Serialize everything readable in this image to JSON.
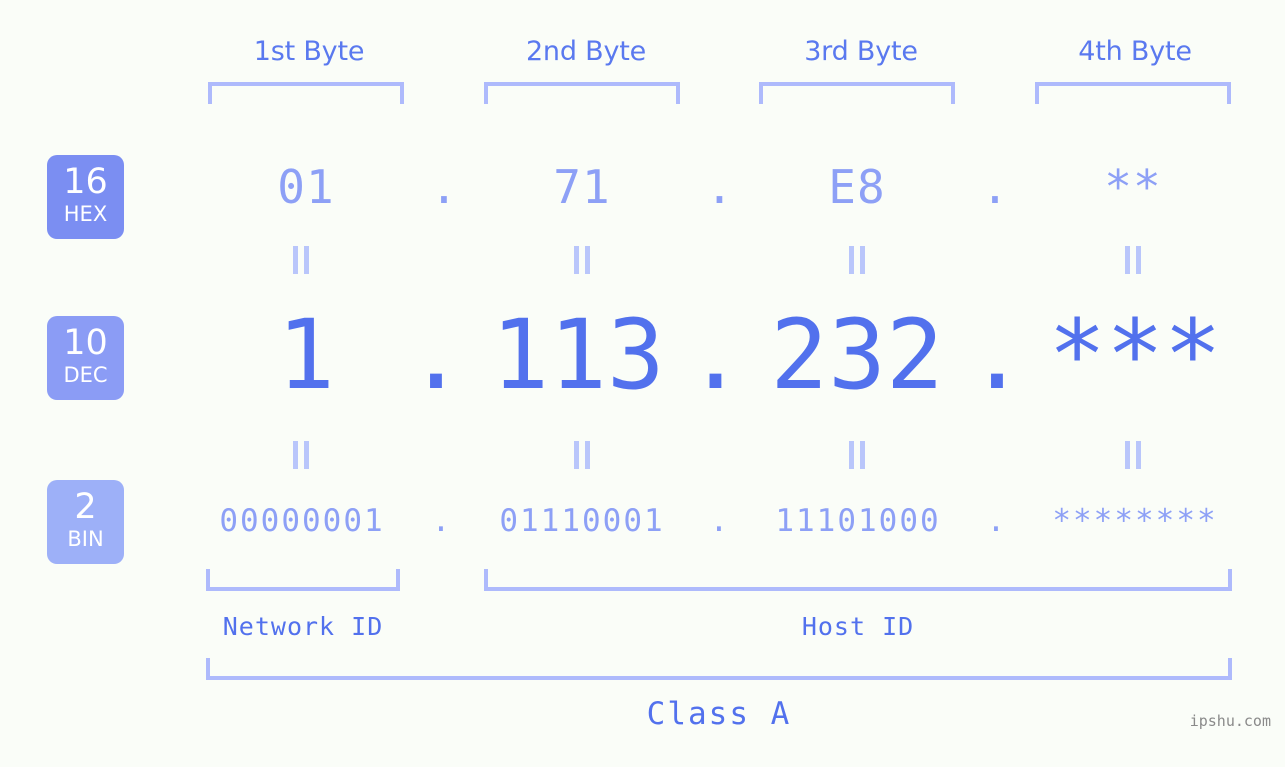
{
  "page": {
    "background_color": "#fafdf8",
    "watermark": "ipshu.com"
  },
  "colors": {
    "primary": "#5271ed",
    "light": "#8da0f6",
    "bracket": "#aebafc",
    "equals": "#b9c6fb",
    "badge_hex": "#7b8ef2",
    "badge_dec": "#8b9cf5",
    "badge_bin": "#9db0f8"
  },
  "byte_headers": [
    {
      "label": "1st Byte"
    },
    {
      "label": "2nd Byte"
    },
    {
      "label": "3rd Byte"
    },
    {
      "label": "4th Byte"
    }
  ],
  "radix_badges": [
    {
      "num": "16",
      "tag": "HEX"
    },
    {
      "num": "10",
      "tag": "DEC"
    },
    {
      "num": "2",
      "tag": "BIN"
    }
  ],
  "rows": {
    "hex": {
      "octets": [
        "01",
        "71",
        "E8",
        "**"
      ],
      "separator": "."
    },
    "dec": {
      "octets": [
        "1",
        "113",
        "232",
        "***"
      ],
      "separator": "."
    },
    "bin": {
      "octets": [
        "00000001",
        "01110001",
        "11101000",
        "********"
      ],
      "separator": "."
    }
  },
  "equals_symbol": "||",
  "zones": [
    {
      "label": "Network ID"
    },
    {
      "label": "Host ID"
    }
  ],
  "class": {
    "label": "Class A"
  }
}
